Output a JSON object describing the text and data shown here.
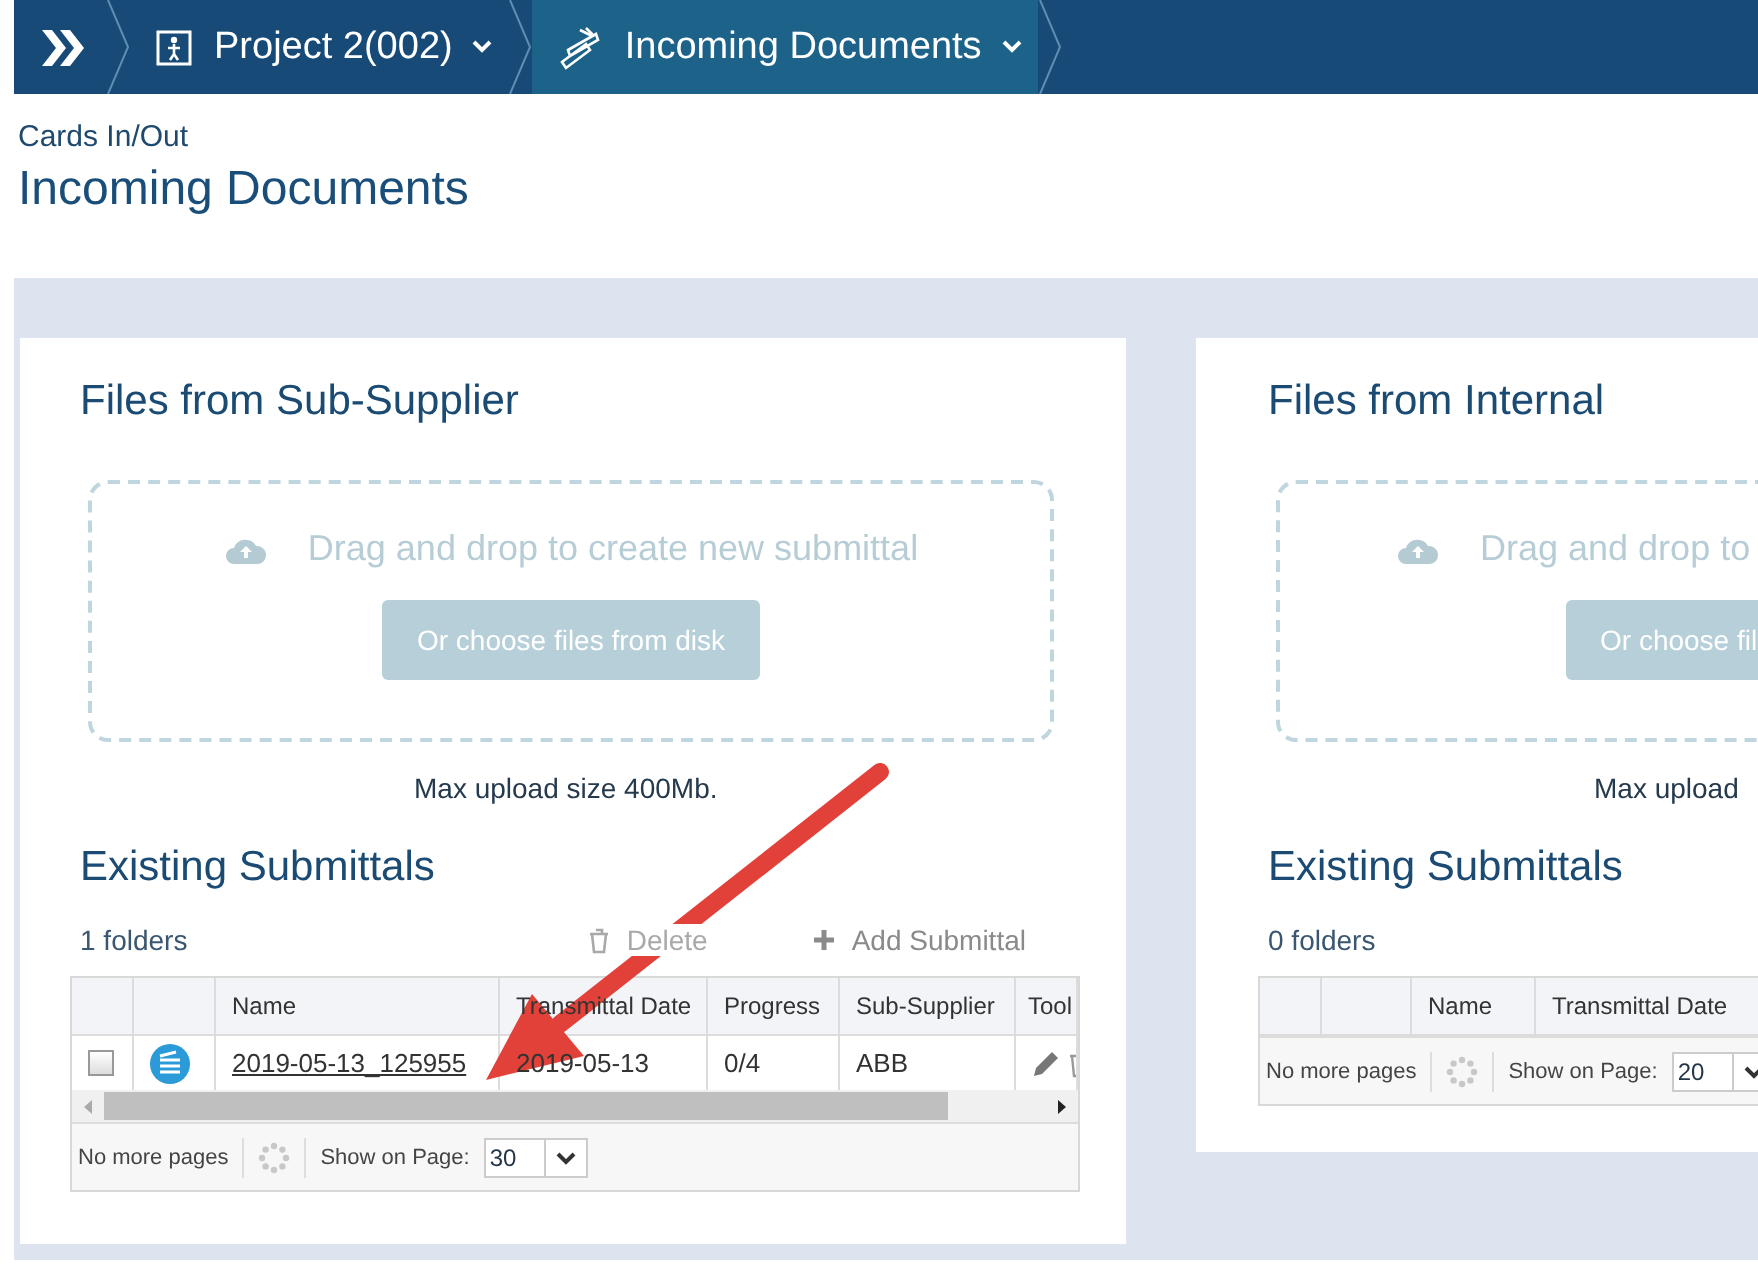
{
  "nav": [
    {
      "kind": "home",
      "selected": false
    },
    {
      "kind": "project",
      "label": "Project 2(002)",
      "selected": false
    },
    {
      "kind": "documents",
      "label": "Incoming Documents",
      "selected": true
    }
  ],
  "breadcrumb": "Cards In/Out",
  "title": "Incoming Documents",
  "panels": [
    {
      "title": "Files from Sub-Supplier",
      "drop_text": "Drag and drop to create new submittal",
      "choose_button": "Or choose files from disk",
      "max_upload": "Max upload size 400Mb.",
      "existing_title": "Existing Submittals",
      "count": "1 folders",
      "actions": [
        {
          "kind": "delete",
          "label": "Delete",
          "disabled": true
        },
        {
          "kind": "add",
          "label": "Add Submittal",
          "disabled": false
        }
      ],
      "columns": [
        {
          "kind": "check"
        },
        {
          "kind": "icon"
        },
        {
          "kind": "link",
          "label": "Name"
        },
        {
          "kind": "text",
          "label": "Transmittal Date"
        },
        {
          "kind": "text",
          "label": "Progress"
        },
        {
          "kind": "text",
          "label": "Sub-Supplier"
        },
        {
          "kind": "tools",
          "label": "Tool"
        }
      ],
      "rows": [
        {
          "checked": false,
          "cells": [
            "",
            "",
            "2019-05-13_125955",
            "2019-05-13",
            "0/4",
            "ABB",
            ""
          ]
        }
      ],
      "footer": {
        "status": "No more pages",
        "show_label": "Show on Page:",
        "page_size": "30"
      }
    },
    {
      "title": "Files from Internal",
      "drop_text": "Drag and drop to",
      "choose_button": "Or choose fil",
      "max_upload": "Max upload",
      "existing_title": "Existing Submittals",
      "count": "0 folders",
      "columns": [
        {
          "kind": "check"
        },
        {
          "kind": "icon"
        },
        {
          "kind": "link",
          "label": "Name"
        },
        {
          "kind": "text",
          "label": "Transmittal Date"
        }
      ],
      "footer": {
        "status": "No more pages",
        "show_label": "Show on Page:",
        "page_size": "20"
      }
    }
  ]
}
